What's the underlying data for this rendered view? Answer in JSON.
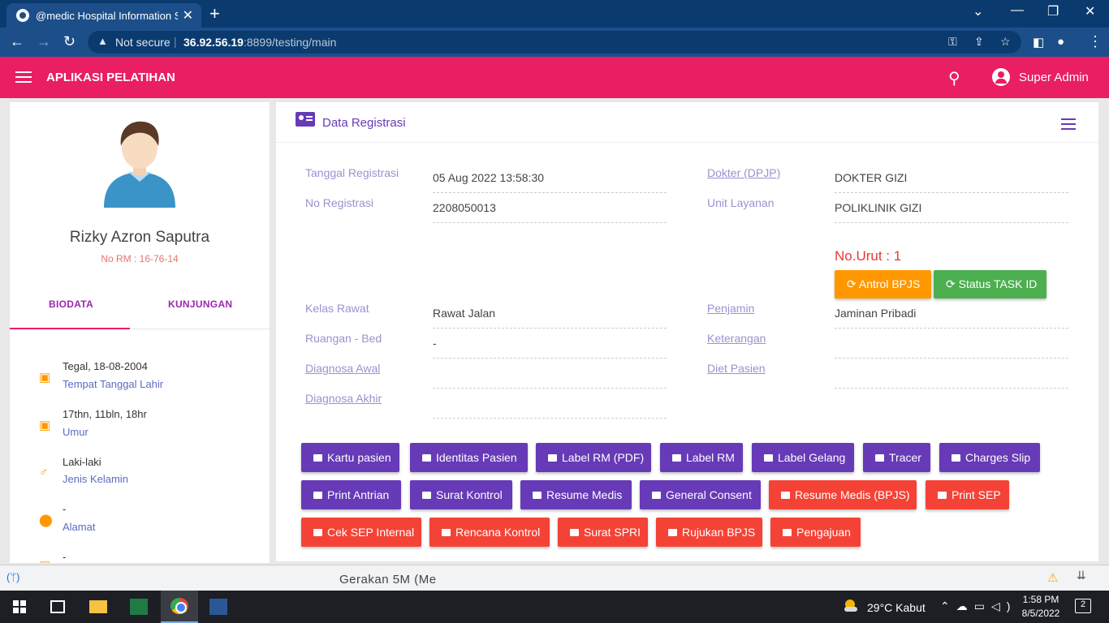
{
  "browser": {
    "tab_title": "@medic Hospital Information Sys",
    "not_secure": "Not secure",
    "url_host": "36.92.56.19",
    "url_rest": ":8899/testing/main"
  },
  "app": {
    "title": "APLIKASI PELATIHAN",
    "user": "Super Admin"
  },
  "patient": {
    "name": "Rizky Azron Saputra",
    "rm": "No RM : 16-76-14",
    "tabs": [
      "BIODATA",
      "KUNJUNGAN"
    ],
    "bio": [
      {
        "value": "Tegal, 18-08-2004",
        "label": "Tempat Tanggal Lahir",
        "icon": "calendar-icon"
      },
      {
        "value": "17thn, 11bln, 18hr",
        "label": "Umur",
        "icon": "calendar-icon"
      },
      {
        "value": "Laki-laki",
        "label": "Jenis Kelamin",
        "icon": "male-icon"
      },
      {
        "value": "-",
        "label": "Alamat",
        "icon": "location-icon"
      },
      {
        "value": "-",
        "label": "",
        "icon": "calendar-icon"
      }
    ]
  },
  "registrasi": {
    "title": "Data Registrasi",
    "left_fields": [
      {
        "label": "Tanggal Registrasi",
        "value": "05 Aug 2022 13:58:30"
      },
      {
        "label": "No Registrasi",
        "value": "2208050013"
      },
      {
        "label": "Kelas Rawat",
        "value": "Rawat Jalan"
      },
      {
        "label": "Ruangan - Bed",
        "value": "-"
      },
      {
        "label": "Diagnosa Awal",
        "value": ""
      },
      {
        "label": "Diagnosa Akhir",
        "value": ""
      }
    ],
    "right_fields": [
      {
        "label": "Dokter (DPJP)",
        "value": "DOKTER GIZI"
      },
      {
        "label": "Unit Layanan",
        "value": "POLIKLINIK GIZI"
      },
      {
        "label": "Penjamin",
        "value": "Jaminan Pribadi"
      },
      {
        "label": "Keterangan",
        "value": ""
      },
      {
        "label": "Diet Pasien",
        "value": ""
      }
    ],
    "no_urut": "No.Urut : 1",
    "antrol_button": "Antrol BPJS",
    "status_button": "Status TASK ID",
    "colors": {
      "antrol": "#ff9800",
      "status": "#4caf50"
    }
  },
  "actions": {
    "row1": [
      "Kartu pasien",
      "Identitas Pasien",
      "Label RM (PDF)",
      "Label RM",
      "Label Gelang",
      "Tracer",
      "Charges Slip"
    ],
    "row2": [
      "Print Antrian",
      "Surat Kontrol",
      "Resume Medis",
      "General Consent",
      "Resume Medis (BPJS)",
      "Print SEP"
    ],
    "row3": [
      "Cek SEP Internal",
      "Rencana Kontrol",
      "Surat SPRI",
      "Rujukan BPJS",
      "Pengajuan"
    ]
  },
  "download_bar": {
    "file": "Gerakan 5M (Me"
  },
  "taskbar": {
    "weather": "29°C  Kabut",
    "time": "1:58 PM",
    "date": "8/5/2022",
    "notifications": "2"
  }
}
